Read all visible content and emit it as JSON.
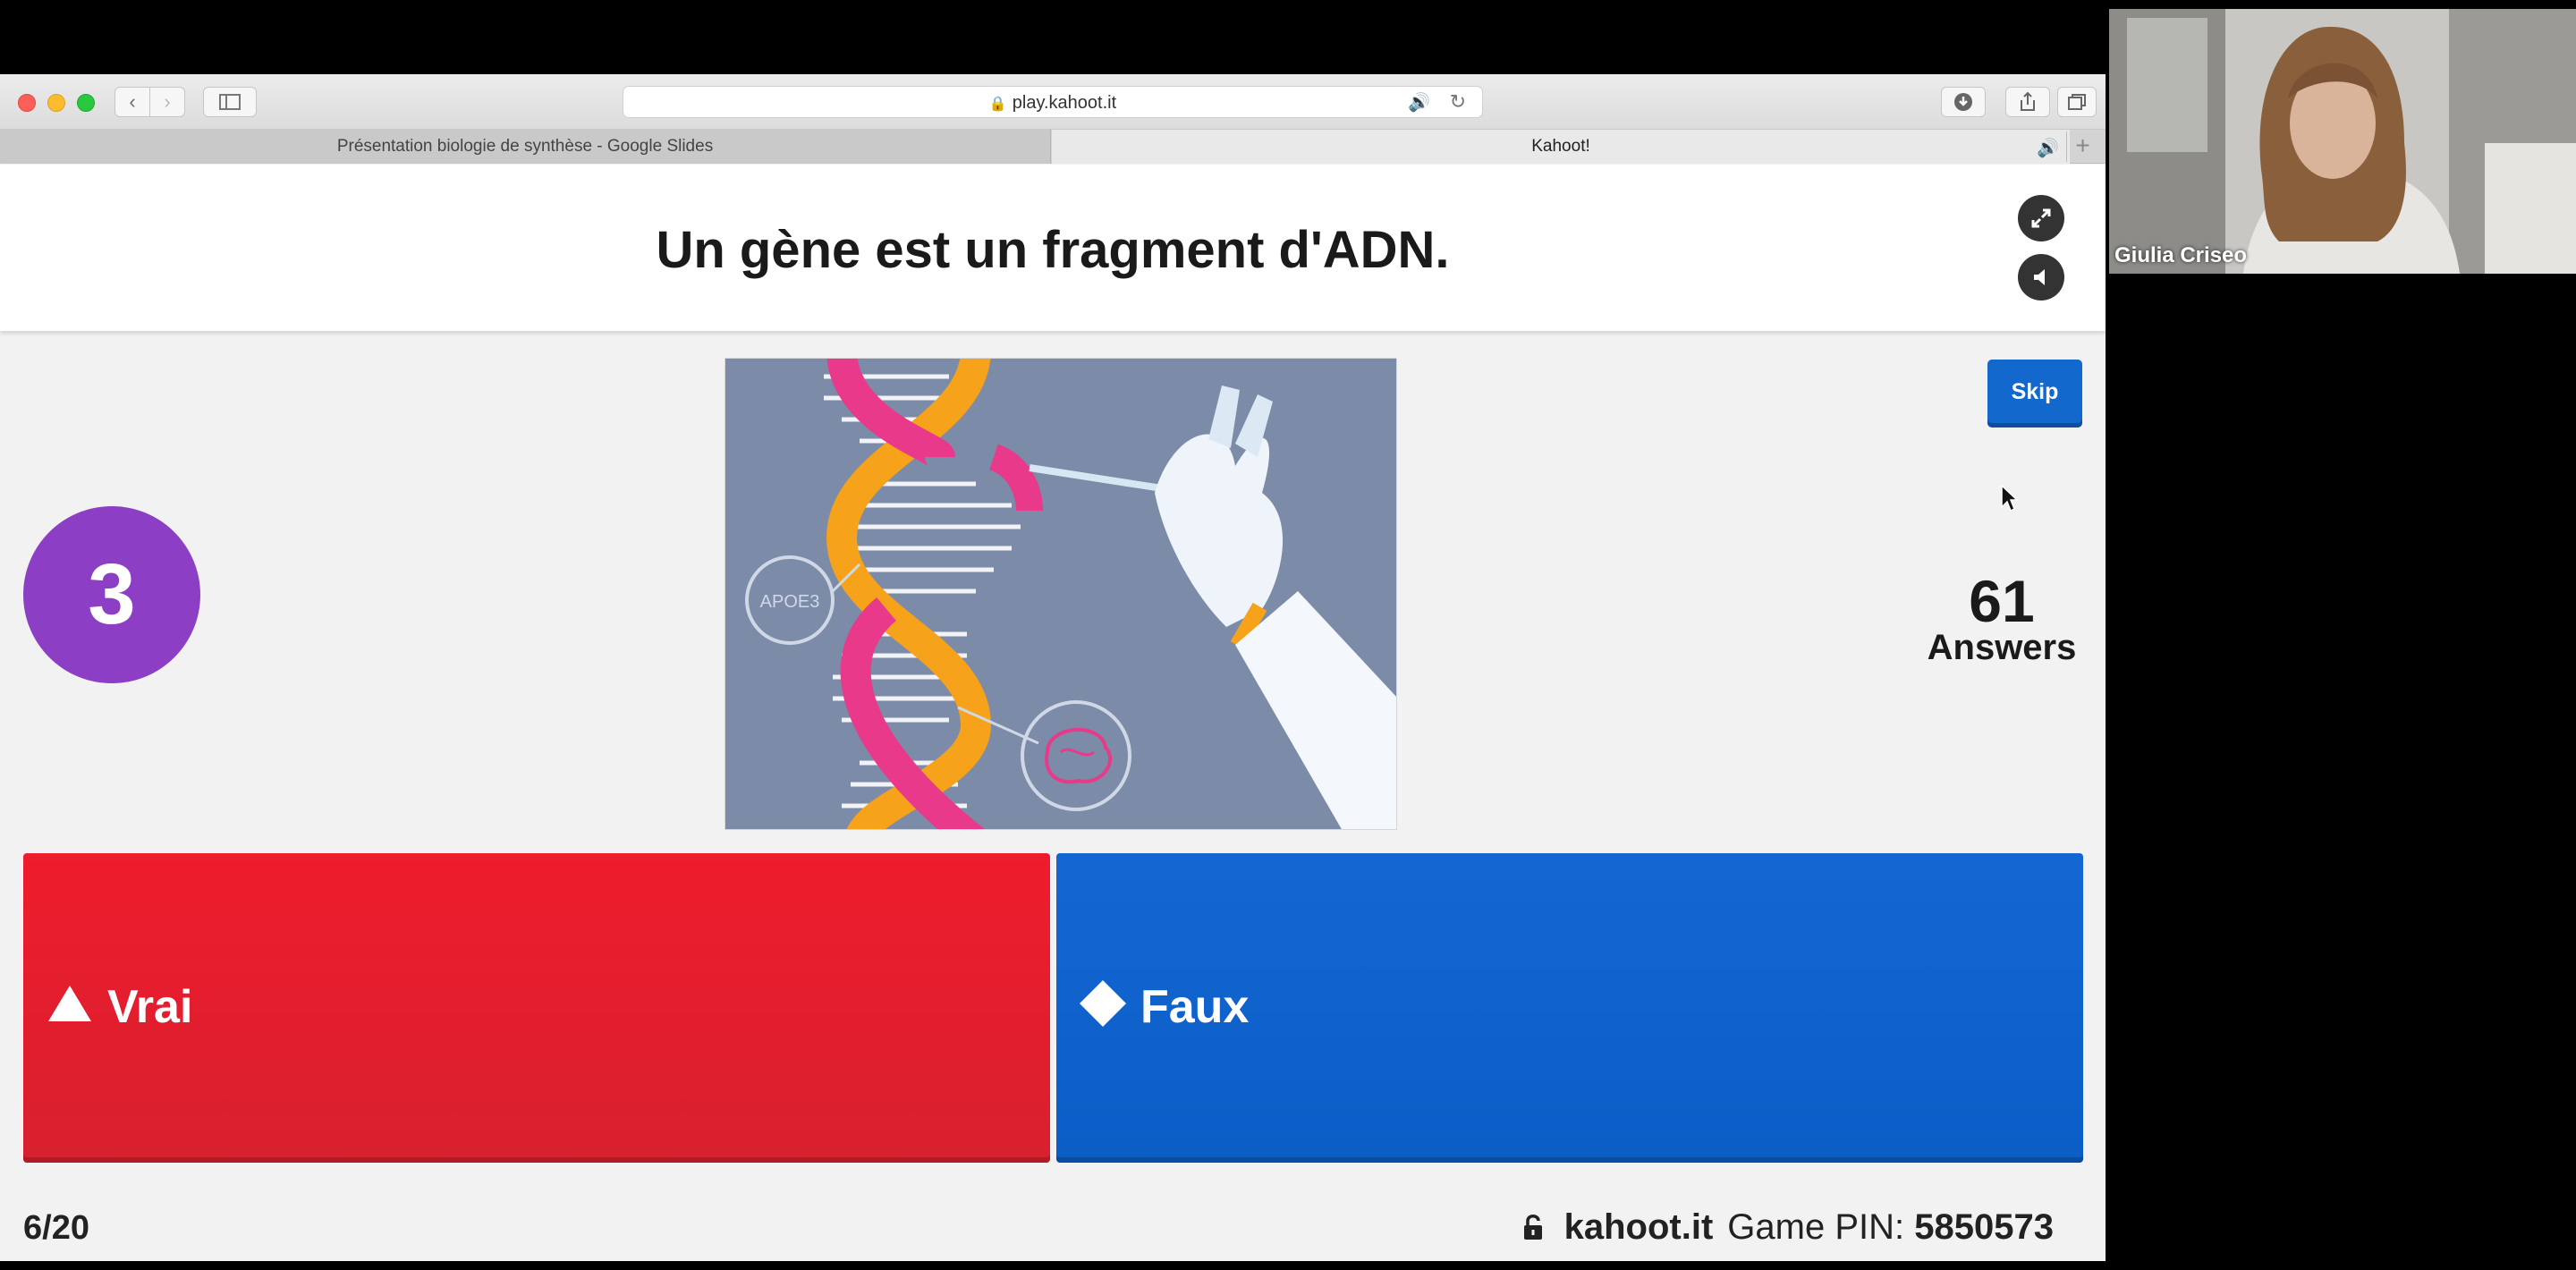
{
  "browser": {
    "url": "play.kahoot.it",
    "tabs": [
      {
        "label": "Présentation biologie de synthèse - Google Slides"
      },
      {
        "label": "Kahoot!"
      }
    ]
  },
  "quiz": {
    "question": "Un gène est un fragment d'ADN.",
    "timer": "3",
    "skip_label": "Skip",
    "answers_count": "61",
    "answers_label": "Answers",
    "image_label": "APOE3",
    "options": [
      {
        "label": "Vrai",
        "shape": "triangle-icon",
        "color": "#e21b3c"
      },
      {
        "label": "Faux",
        "shape": "diamond-icon",
        "color": "#1368ce"
      }
    ]
  },
  "footer": {
    "progress": "6/20",
    "site": "kahoot.it",
    "pin_label": "Game PIN:",
    "pin_value": "5850573"
  },
  "webcam": {
    "name": "Giulia Criseo"
  }
}
